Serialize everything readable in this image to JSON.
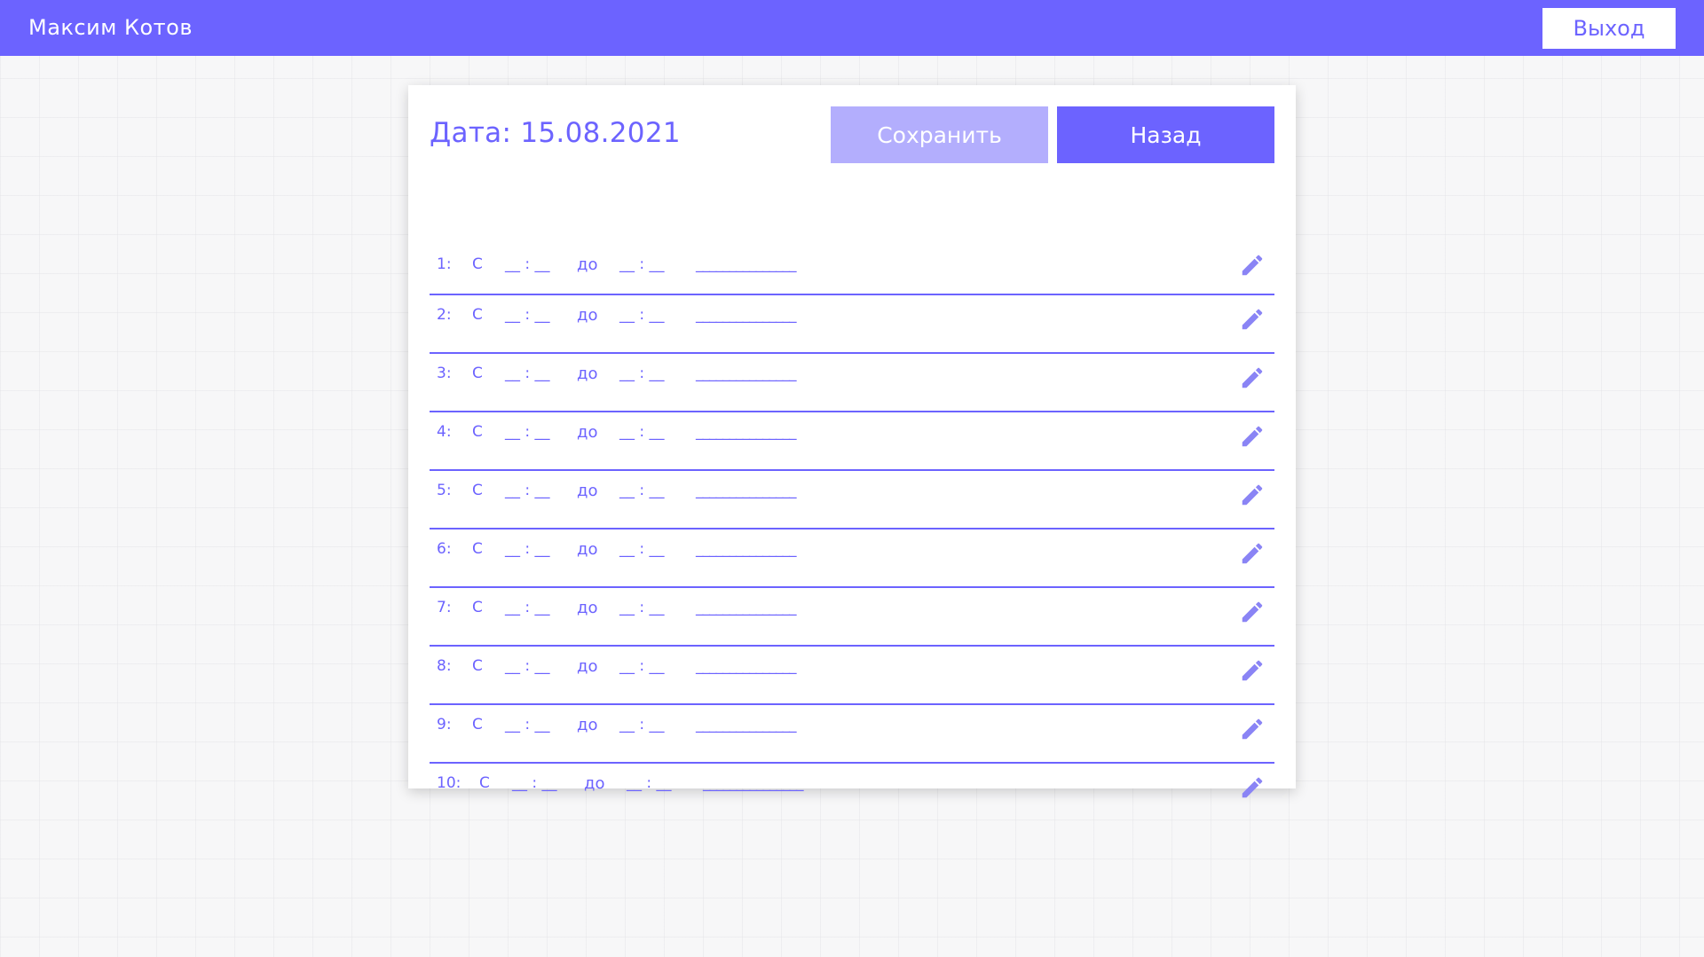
{
  "header": {
    "user_name": "Максим Котов",
    "logout_label": "Выход"
  },
  "card": {
    "date_label": "Дата: 15.08.2021",
    "save_label": "Сохранить",
    "back_label": "Назад",
    "rows": [
      {
        "num": "1:",
        "from": "С",
        "t1": "__ : __",
        "to": "до",
        "t2": "__ : __",
        "name": "_______________",
        "icon": "pencil-icon"
      },
      {
        "num": "2:",
        "from": "С",
        "t1": "__ : __",
        "to": "до",
        "t2": "__ : __",
        "name": "_______________",
        "icon": "pencil-icon"
      },
      {
        "num": "3:",
        "from": "С",
        "t1": "__ : __",
        "to": "до",
        "t2": "__ : __",
        "name": "_______________",
        "icon": "pencil-icon"
      },
      {
        "num": "4:",
        "from": "С",
        "t1": "__ : __",
        "to": "до",
        "t2": "__ : __",
        "name": "_______________",
        "icon": "pencil-icon"
      },
      {
        "num": "5:",
        "from": "С",
        "t1": "__ : __",
        "to": "до",
        "t2": "__ : __",
        "name": "_______________",
        "icon": "pencil-icon"
      },
      {
        "num": "6:",
        "from": "С",
        "t1": "__ : __",
        "to": "до",
        "t2": "__ : __",
        "name": "_______________",
        "icon": "pencil-icon"
      },
      {
        "num": "7:",
        "from": "С",
        "t1": "__ : __",
        "to": "до",
        "t2": "__ : __",
        "name": "_______________",
        "icon": "pencil-icon"
      },
      {
        "num": "8:",
        "from": "С",
        "t1": "__ : __",
        "to": "до",
        "t2": "__ : __",
        "name": "_______________",
        "icon": "pencil-icon"
      },
      {
        "num": "9:",
        "from": "С",
        "t1": "__ : __",
        "to": "до",
        "t2": "__ : __",
        "name": "_______________",
        "icon": "pencil-icon"
      },
      {
        "num": "10:",
        "from": "С",
        "t1": "__ : __",
        "to": "до",
        "t2": "__ : __",
        "name": "_______________",
        "icon": "pencil-icon"
      }
    ]
  },
  "colors": {
    "accent": "#6c63ff",
    "accent_light": "#b3aefd",
    "background": "#f7f7f8"
  }
}
